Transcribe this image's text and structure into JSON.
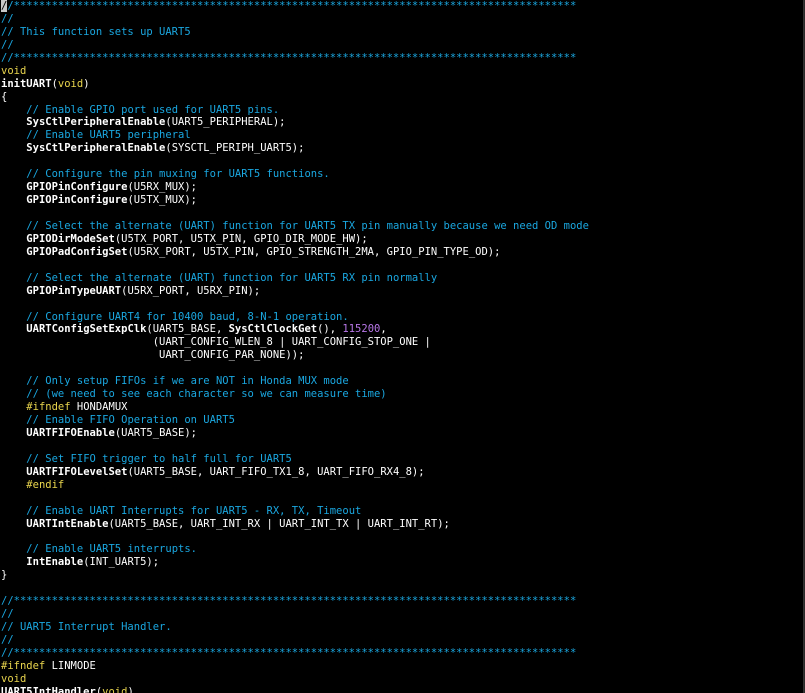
{
  "colors": {
    "background": "#000000",
    "comment": "#1aa7e0",
    "type_keyword": "#e8d44d",
    "function": "#ffffff",
    "number": "#b877e8",
    "preprocessor": "#e8d44d"
  },
  "lines": [
    [
      [
        "cursor",
        "/"
      ],
      [
        "comment",
        "/*****************************************************************************************"
      ]
    ],
    [
      [
        "comment",
        "//"
      ]
    ],
    [
      [
        "comment",
        "// This function sets up UART5"
      ]
    ],
    [
      [
        "comment",
        "//"
      ]
    ],
    [
      [
        "comment",
        "//*****************************************************************************************"
      ]
    ],
    [
      [
        "type",
        "void"
      ]
    ],
    [
      [
        "func",
        "initUART"
      ],
      [
        "plain",
        "("
      ],
      [
        "type",
        "void"
      ],
      [
        "plain",
        ")"
      ]
    ],
    [
      [
        "plain",
        "{"
      ]
    ],
    [
      [
        "plain",
        "    "
      ],
      [
        "comment",
        "// Enable GPIO port used for UART5 pins."
      ]
    ],
    [
      [
        "plain",
        "    "
      ],
      [
        "func",
        "SysCtlPeripheralEnable"
      ],
      [
        "plain",
        "(UART5_PERIPHERAL);"
      ]
    ],
    [
      [
        "plain",
        "    "
      ],
      [
        "comment",
        "// Enable UART5 peripheral"
      ]
    ],
    [
      [
        "plain",
        "    "
      ],
      [
        "func",
        "SysCtlPeripheralEnable"
      ],
      [
        "plain",
        "(SYSCTL_PERIPH_UART5);"
      ]
    ],
    [
      [
        "plain",
        ""
      ]
    ],
    [
      [
        "plain",
        "    "
      ],
      [
        "comment",
        "// Configure the pin muxing for UART5 functions."
      ]
    ],
    [
      [
        "plain",
        "    "
      ],
      [
        "func",
        "GPIOPinConfigure"
      ],
      [
        "plain",
        "(U5RX_MUX);"
      ]
    ],
    [
      [
        "plain",
        "    "
      ],
      [
        "func",
        "GPIOPinConfigure"
      ],
      [
        "plain",
        "(U5TX_MUX);"
      ]
    ],
    [
      [
        "plain",
        ""
      ]
    ],
    [
      [
        "plain",
        "    "
      ],
      [
        "comment",
        "// Select the alternate (UART) function for UART5 TX pin manually because we need OD mode"
      ]
    ],
    [
      [
        "plain",
        "    "
      ],
      [
        "func",
        "GPIODirModeSet"
      ],
      [
        "plain",
        "(U5TX_PORT, U5TX_PIN, GPIO_DIR_MODE_HW);"
      ]
    ],
    [
      [
        "plain",
        "    "
      ],
      [
        "func",
        "GPIOPadConfigSet"
      ],
      [
        "plain",
        "(U5RX_PORT, U5TX_PIN, GPIO_STRENGTH_2MA, GPIO_PIN_TYPE_OD);"
      ]
    ],
    [
      [
        "plain",
        ""
      ]
    ],
    [
      [
        "plain",
        "    "
      ],
      [
        "comment",
        "// Select the alternate (UART) function for UART5 RX pin normally"
      ]
    ],
    [
      [
        "plain",
        "    "
      ],
      [
        "func",
        "GPIOPinTypeUART"
      ],
      [
        "plain",
        "(U5RX_PORT, U5RX_PIN);"
      ]
    ],
    [
      [
        "plain",
        ""
      ]
    ],
    [
      [
        "plain",
        "    "
      ],
      [
        "comment",
        "// Configure UART4 for 10400 baud, 8-N-1 operation."
      ]
    ],
    [
      [
        "plain",
        "    "
      ],
      [
        "func",
        "UARTConfigSetExpClk"
      ],
      [
        "plain",
        "(UART5_BASE, "
      ],
      [
        "func",
        "SysCtlClockGet"
      ],
      [
        "plain",
        "(), "
      ],
      [
        "num",
        "115200"
      ],
      [
        "plain",
        ","
      ]
    ],
    [
      [
        "plain",
        "                        (UART_CONFIG_WLEN_8 | UART_CONFIG_STOP_ONE |"
      ]
    ],
    [
      [
        "plain",
        "                         UART_CONFIG_PAR_NONE));"
      ]
    ],
    [
      [
        "plain",
        ""
      ]
    ],
    [
      [
        "plain",
        "    "
      ],
      [
        "comment",
        "// Only setup FIFOs if we are NOT in Honda MUX mode"
      ]
    ],
    [
      [
        "plain",
        "    "
      ],
      [
        "comment",
        "// (we need to see each character so we can measure time)"
      ]
    ],
    [
      [
        "plain",
        "    "
      ],
      [
        "pre",
        "#ifndef"
      ],
      [
        "plain",
        " HONDAMUX"
      ]
    ],
    [
      [
        "plain",
        "    "
      ],
      [
        "comment",
        "// Enable FIFO Operation on UART5"
      ]
    ],
    [
      [
        "plain",
        "    "
      ],
      [
        "func",
        "UARTFIFOEnable"
      ],
      [
        "plain",
        "(UART5_BASE);"
      ]
    ],
    [
      [
        "plain",
        ""
      ]
    ],
    [
      [
        "plain",
        "    "
      ],
      [
        "comment",
        "// Set FIFO trigger to half full for UART5"
      ]
    ],
    [
      [
        "plain",
        "    "
      ],
      [
        "func",
        "UARTFIFOLevelSet"
      ],
      [
        "plain",
        "(UART5_BASE, UART_FIFO_TX1_8, UART_FIFO_RX4_8);"
      ]
    ],
    [
      [
        "plain",
        "    "
      ],
      [
        "pre",
        "#endif"
      ]
    ],
    [
      [
        "plain",
        ""
      ]
    ],
    [
      [
        "plain",
        "    "
      ],
      [
        "comment",
        "// Enable UART Interrupts for UART5 - RX, TX, Timeout"
      ]
    ],
    [
      [
        "plain",
        "    "
      ],
      [
        "func",
        "UARTIntEnable"
      ],
      [
        "plain",
        "(UART5_BASE, UART_INT_RX | UART_INT_TX | UART_INT_RT);"
      ]
    ],
    [
      [
        "plain",
        ""
      ]
    ],
    [
      [
        "plain",
        "    "
      ],
      [
        "comment",
        "// Enable UART5 interrupts."
      ]
    ],
    [
      [
        "plain",
        "    "
      ],
      [
        "func",
        "IntEnable"
      ],
      [
        "plain",
        "(INT_UART5);"
      ]
    ],
    [
      [
        "plain",
        "}"
      ]
    ],
    [
      [
        "plain",
        ""
      ]
    ],
    [
      [
        "comment",
        "//*****************************************************************************************"
      ]
    ],
    [
      [
        "comment",
        "//"
      ]
    ],
    [
      [
        "comment",
        "// UART5 Interrupt Handler."
      ]
    ],
    [
      [
        "comment",
        "//"
      ]
    ],
    [
      [
        "comment",
        "//*****************************************************************************************"
      ]
    ],
    [
      [
        "pre",
        "#ifndef"
      ],
      [
        "plain",
        " LINMODE"
      ]
    ],
    [
      [
        "type",
        "void"
      ]
    ],
    [
      [
        "func",
        "UART5IntHandler"
      ],
      [
        "plain",
        "("
      ],
      [
        "type",
        "void"
      ],
      [
        "plain",
        ")"
      ]
    ]
  ]
}
